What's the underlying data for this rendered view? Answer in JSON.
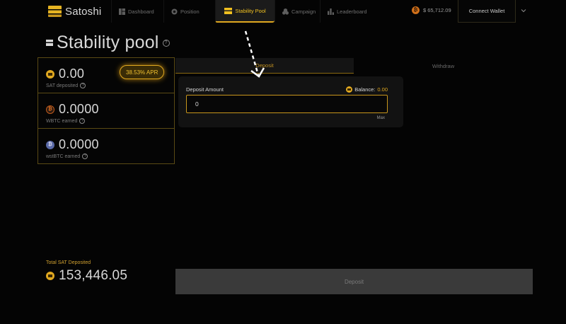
{
  "app": {
    "brand": "Satoshi",
    "accent": "#e0a820"
  },
  "nav": {
    "items": [
      {
        "label": "Dashboard",
        "icon": "dashboard-icon",
        "active": false
      },
      {
        "label": "Position",
        "icon": "position-icon",
        "active": false
      },
      {
        "label": "Stability Pool",
        "icon": "stability-pool-icon",
        "active": true
      },
      {
        "label": "Campaign",
        "icon": "campaign-icon",
        "active": false
      },
      {
        "label": "Leaderboard",
        "icon": "leaderboard-icon",
        "active": false
      }
    ],
    "btc_price": "$ 65,712.09",
    "connect_label": "Connect Wallet"
  },
  "page": {
    "title": "Stability pool",
    "help_glyph": "?"
  },
  "stats": {
    "sat_deposited": {
      "value": "0.00",
      "label": "SAT deposited"
    },
    "apr": "38.53% APR",
    "wbtc_earned": {
      "value": "0.0000",
      "label": "WBTC earned"
    },
    "wstbtc_earned": {
      "value": "0.0000",
      "label": "wstBTC earned"
    },
    "total_label": "Total SAT Deposited",
    "total_value": "153,446.05"
  },
  "form": {
    "tabs": [
      "Deposit",
      "Withdraw"
    ],
    "active_tab": "Deposit",
    "amount_label": "Deposit Amount",
    "balance_label": "Balance:",
    "balance_value": "0.00",
    "amount_value": "0",
    "max_label": "Max",
    "submit_label": "Deposit"
  }
}
